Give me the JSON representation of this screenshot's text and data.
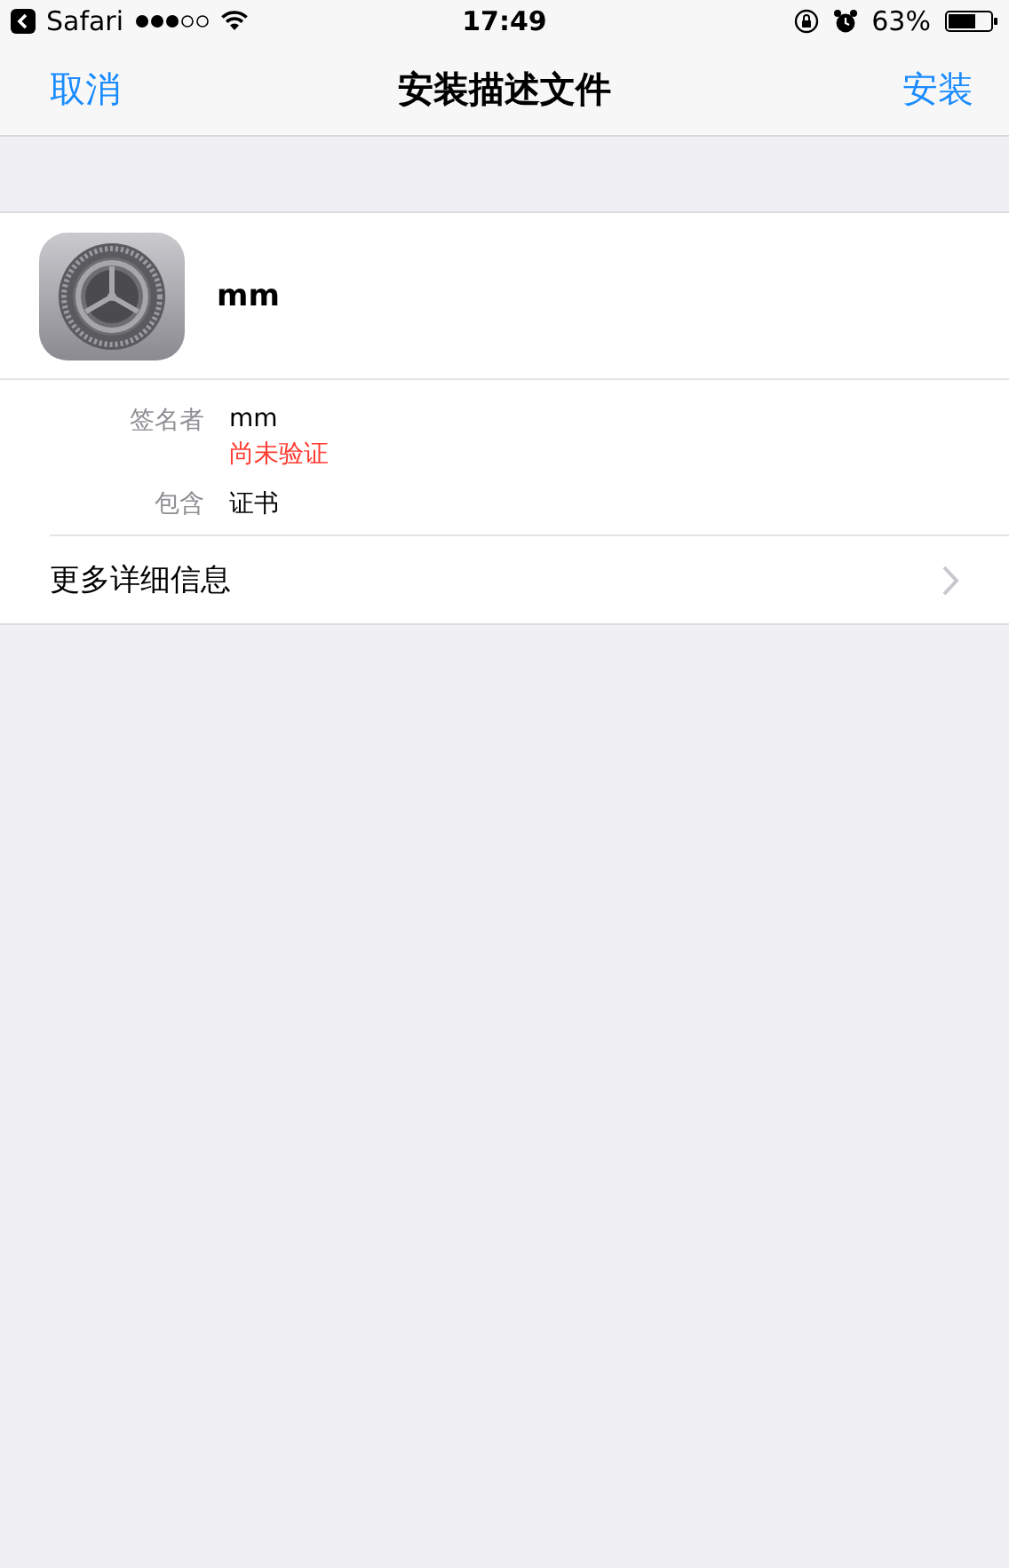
{
  "status_bar": {
    "back_app": "Safari",
    "time": "17:49",
    "battery": "63%"
  },
  "nav_bar": {
    "cancel": "取消",
    "title": "安装描述文件",
    "install": "安装"
  },
  "profile": {
    "name": "mm",
    "details": [
      {
        "label": "签名者",
        "values": [
          {
            "text": "mm",
            "kind": "normal"
          },
          {
            "text": "尚未验证",
            "kind": "warning"
          }
        ]
      },
      {
        "label": "包含",
        "values": [
          {
            "text": "证书",
            "kind": "normal"
          }
        ]
      }
    ],
    "more": "更多详细信息"
  }
}
